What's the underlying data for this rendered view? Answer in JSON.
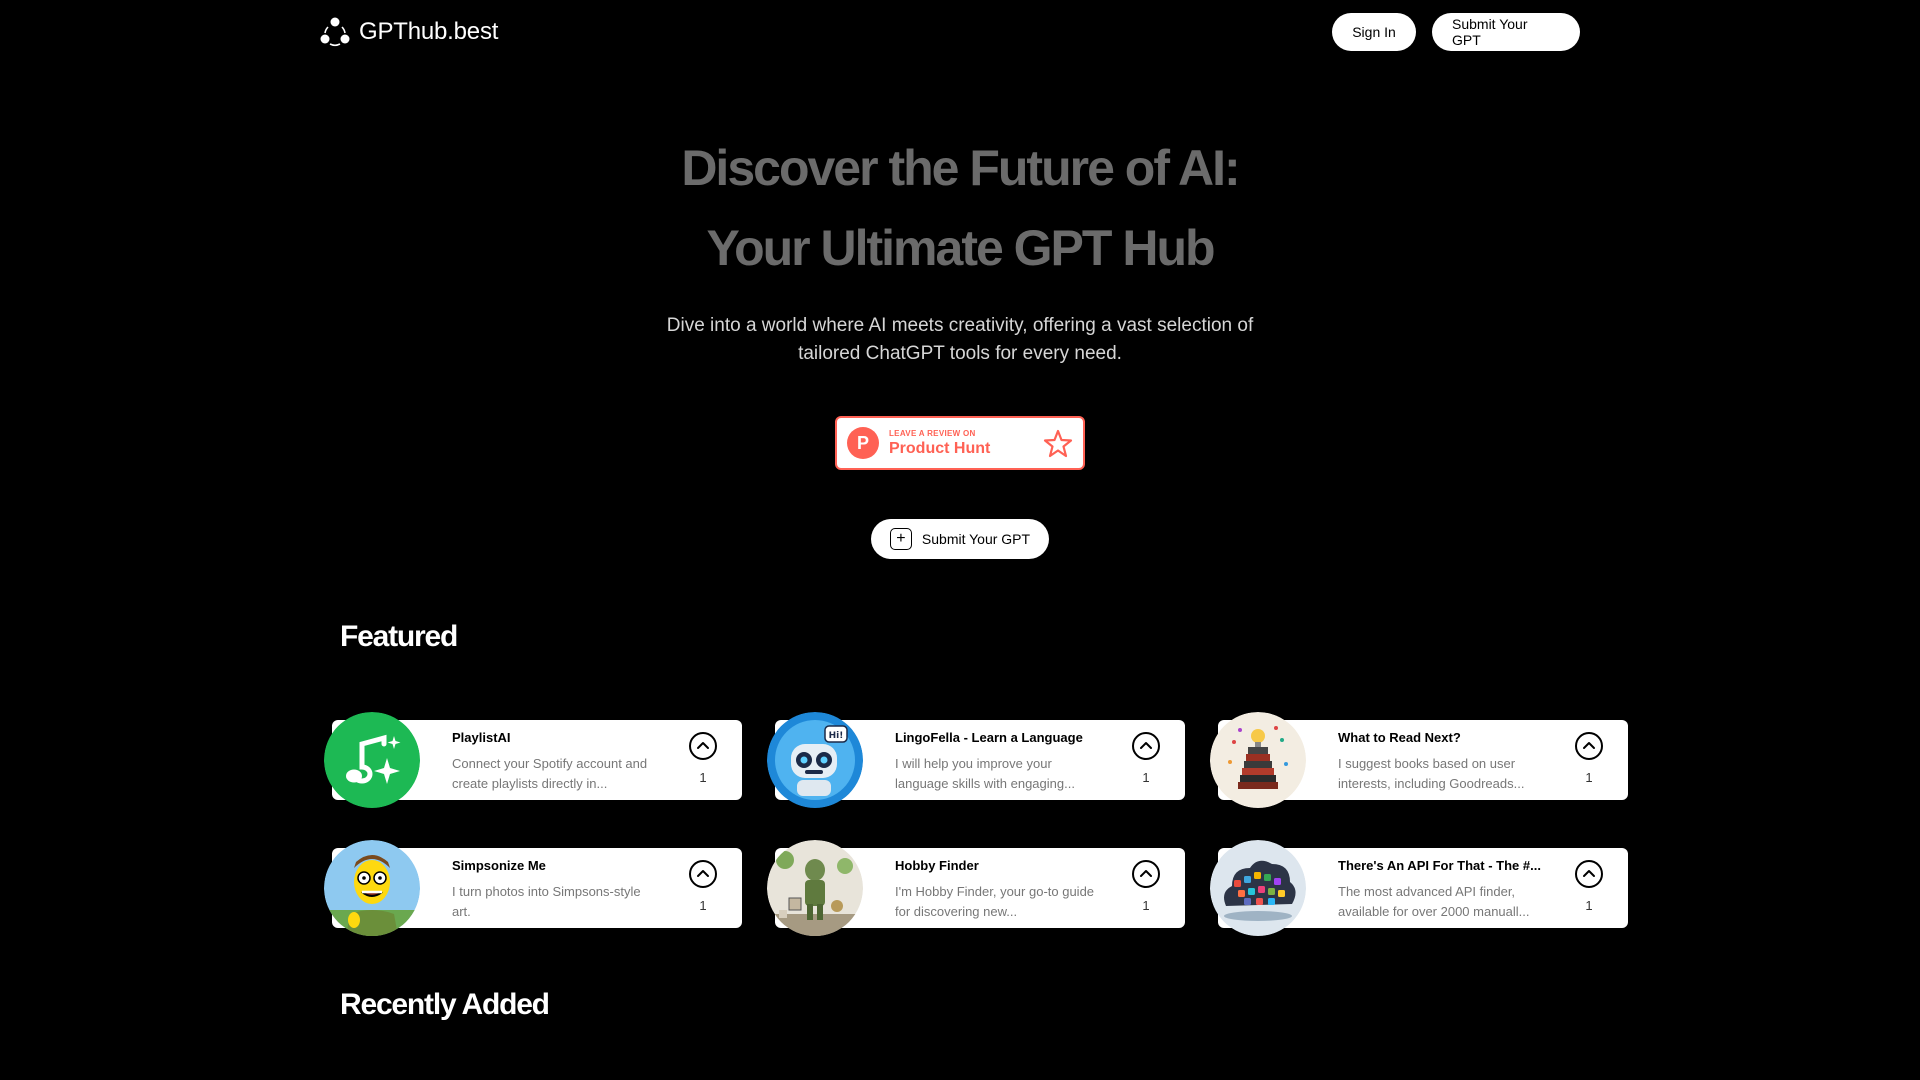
{
  "header": {
    "logo_text": "GPThub.best",
    "signin_label": "Sign In",
    "submit_label": "Submit Your GPT"
  },
  "hero": {
    "title_line1": "Discover the Future of AI:",
    "title_line2": "Your Ultimate GPT Hub",
    "subtitle": "Dive into a world where AI meets creativity, offering a vast selection of tailored ChatGPT tools for every need.",
    "product_hunt_small": "LEAVE A REVIEW ON",
    "product_hunt_big": "Product Hunt",
    "product_hunt_logo": "P",
    "submit_label": "Submit Your GPT",
    "plus_symbol": "+"
  },
  "sections": {
    "featured_title": "Featured",
    "recent_title": "Recently Added"
  },
  "featured": [
    {
      "name": "PlaylistAI",
      "desc": "Connect your Spotify account and create playlists directly in...",
      "votes": "1",
      "icon": "music-sparkle-icon"
    },
    {
      "name": "LingoFella - Learn a Language",
      "desc": "I will help you improve your language skills with engaging...",
      "votes": "1",
      "icon": "robot-icon"
    },
    {
      "name": "What to Read Next?",
      "desc": "I suggest books based on user interests, including Goodreads...",
      "votes": "1",
      "icon": "books-icon"
    },
    {
      "name": "Simpsonize Me",
      "desc": "I turn photos into Simpsons-style art.",
      "votes": "1",
      "icon": "cartoon-face-icon"
    },
    {
      "name": "Hobby Finder",
      "desc": "I'm Hobby Finder, your go-to guide for discovering new...",
      "votes": "1",
      "icon": "hobby-figure-icon"
    },
    {
      "name": "There's An API For That - The #...",
      "desc": "The most advanced API finder, available for over 2000 manuall...",
      "votes": "1",
      "icon": "cloud-apps-icon"
    }
  ],
  "colors": {
    "background": "#000000",
    "product_hunt": "#ff6154",
    "title_gray": "#6b6b6b"
  }
}
